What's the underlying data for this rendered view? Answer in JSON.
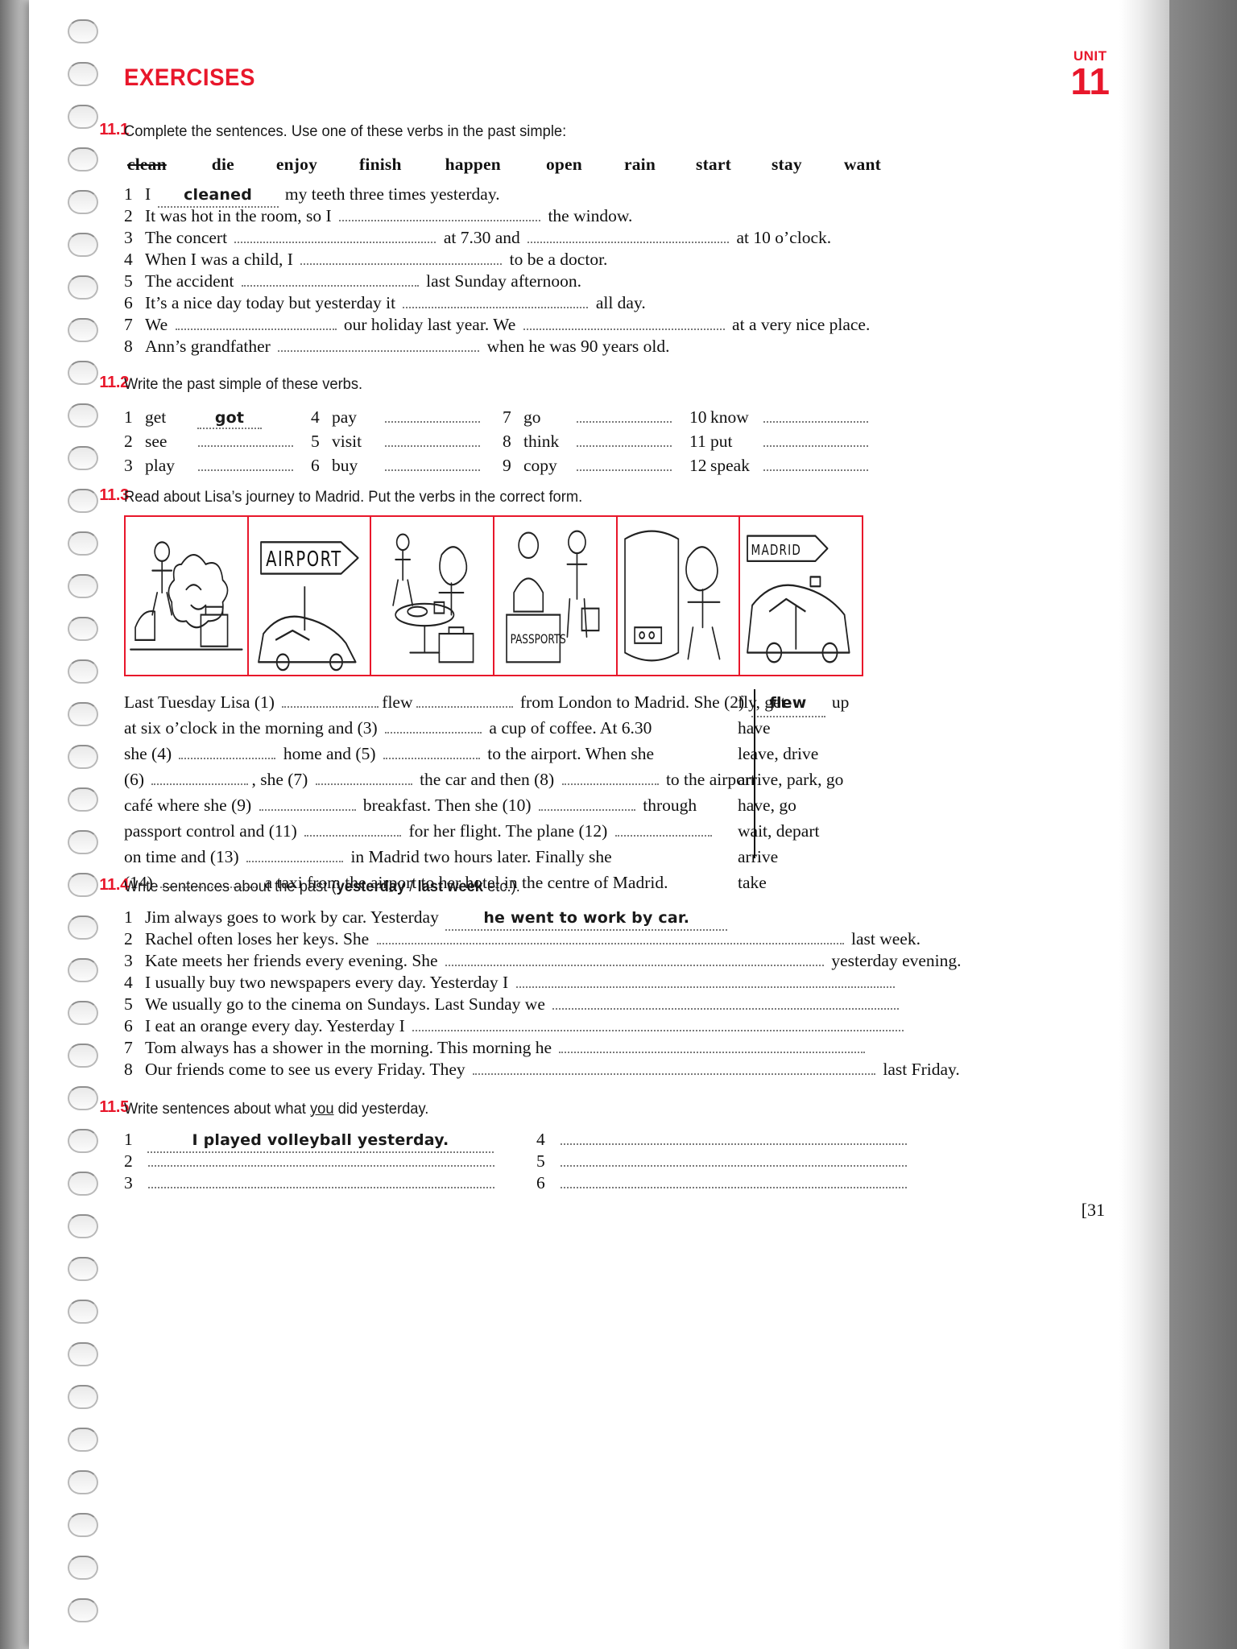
{
  "unit": {
    "label": "UNIT",
    "number": "11"
  },
  "header": {
    "title": "EXERCISES"
  },
  "page_number": "[31",
  "colors": {
    "accent_red": "#e8172b",
    "text": "#111111",
    "dots": "#7a7a7a"
  },
  "exercises": [
    {
      "number": "11.1",
      "instruction": "Complete the sentences. Use one of these verbs in the past simple:",
      "word_bank": [
        {
          "word": "clean",
          "struck": true
        },
        {
          "word": "die",
          "struck": false
        },
        {
          "word": "enjoy",
          "struck": false
        },
        {
          "word": "finish",
          "struck": false
        },
        {
          "word": "happen",
          "struck": false
        },
        {
          "word": "open",
          "struck": false
        },
        {
          "word": "rain",
          "struck": false
        },
        {
          "word": "start",
          "struck": false
        },
        {
          "word": "stay",
          "struck": false
        },
        {
          "word": "want",
          "struck": false
        }
      ],
      "items": [
        {
          "n": "1",
          "pre": "I",
          "answer": "cleaned",
          "post": "my teeth three times yesterday."
        },
        {
          "n": "2",
          "pre": "It was hot in the room, so I",
          "answer": "",
          "post": "the window."
        },
        {
          "n": "3",
          "pre": "The concert",
          "answer": "",
          "mid": "at 7.30 and",
          "post": "at 10 o’clock."
        },
        {
          "n": "4",
          "pre": "When I was a child, I",
          "answer": "",
          "post": "to be a doctor."
        },
        {
          "n": "5",
          "pre": "The accident",
          "answer": "",
          "post": "last Sunday afternoon."
        },
        {
          "n": "6",
          "pre": "It’s a nice day today but yesterday it",
          "answer": "",
          "post": "all day."
        },
        {
          "n": "7",
          "pre": "We",
          "answer": "",
          "mid": "our holiday last year. We",
          "post": "at a very nice place."
        },
        {
          "n": "8",
          "pre": "Ann’s grandfather",
          "answer": "",
          "post": "when he was 90 years old."
        }
      ]
    },
    {
      "number": "11.2",
      "instruction": "Write the past simple of these verbs.",
      "verbs": [
        {
          "n": "1",
          "verb": "get",
          "answer": "got"
        },
        {
          "n": "2",
          "verb": "see",
          "answer": ""
        },
        {
          "n": "3",
          "verb": "play",
          "answer": ""
        },
        {
          "n": "4",
          "verb": "pay",
          "answer": ""
        },
        {
          "n": "5",
          "verb": "visit",
          "answer": ""
        },
        {
          "n": "6",
          "verb": "buy",
          "answer": ""
        },
        {
          "n": "7",
          "verb": "go",
          "answer": ""
        },
        {
          "n": "8",
          "verb": "think",
          "answer": ""
        },
        {
          "n": "9",
          "verb": "copy",
          "answer": ""
        },
        {
          "n": "10",
          "verb": "know",
          "answer": ""
        },
        {
          "n": "11",
          "verb": "put",
          "answer": ""
        },
        {
          "n": "12",
          "verb": "speak",
          "answer": ""
        }
      ]
    },
    {
      "number": "11.3",
      "instruction": "Read about Lisa’s journey to Madrid. Put the verbs in the correct form.",
      "comic_panels": [
        {
          "caption": "",
          "scene": "lisa-in-bed-alarm"
        },
        {
          "caption": "AIRPORT",
          "scene": "airport-sign-car"
        },
        {
          "caption": "",
          "scene": "cafe-coffee-suitcase"
        },
        {
          "caption": "PASSPORTS",
          "scene": "passport-control"
        },
        {
          "caption": "",
          "scene": "plane-window-seat"
        },
        {
          "caption": "MADRID",
          "scene": "taxi-madrid"
        }
      ],
      "passage_lines": [
        "Last Tuesday Lisa (1) ____flew____ from London to Madrid. She (2) ________ up",
        "at six o’clock in the morning and (3) ________ a cup of coffee. At 6.30",
        "she (4) ________ home and (5) ________ to the airport. When she",
        "(6) ________, she (7) ________ the car and then (8) ________ to the airport",
        "café where she (9) ________ breakfast. Then she (10) ________ through",
        "passport control and (11) ________ for her flight. The plane (12) ________",
        "on time and (13) ________ in Madrid two hours later. Finally she",
        "(14) ________ a taxi from the airport to her hotel in the centre of Madrid."
      ],
      "filled_answer": "flew",
      "hints": [
        "fly, get",
        "have",
        "leave, drive",
        "arrive, park, go",
        "have, go",
        "wait, depart",
        "arrive",
        "take"
      ]
    },
    {
      "number": "11.4",
      "instruction_parts": [
        {
          "text": "Write sentences about the past (",
          "bold": false
        },
        {
          "text": "yesterday",
          "bold": true
        },
        {
          "text": " / ",
          "bold": false
        },
        {
          "text": "last week",
          "bold": true
        },
        {
          "text": " etc.).",
          "bold": false
        }
      ],
      "items": [
        {
          "n": "1",
          "pre": "Jim always goes to work by car.  Yesterday",
          "answer": "he went to work by car.",
          "post": ""
        },
        {
          "n": "2",
          "pre": "Rachel often loses her keys.  She",
          "answer": "",
          "post": "last week."
        },
        {
          "n": "3",
          "pre": "Kate meets her friends every evening.  She",
          "answer": "",
          "post": "yesterday evening."
        },
        {
          "n": "4",
          "pre": "I usually buy two newspapers every day.  Yesterday I",
          "answer": "",
          "post": ""
        },
        {
          "n": "5",
          "pre": "We usually go to the cinema on Sundays.  Last Sunday we",
          "answer": "",
          "post": ""
        },
        {
          "n": "6",
          "pre": "I eat an orange every day.  Yesterday I",
          "answer": "",
          "post": ""
        },
        {
          "n": "7",
          "pre": "Tom always has a shower in the morning.  This morning he",
          "answer": "",
          "post": ""
        },
        {
          "n": "8",
          "pre": "Our friends come to see us every Friday.  They",
          "answer": "",
          "post": "last Friday."
        }
      ]
    },
    {
      "number": "11.5",
      "instruction_parts": [
        {
          "text": "Write sentences about what ",
          "bold": false,
          "underline": false
        },
        {
          "text": "you",
          "bold": false,
          "underline": true
        },
        {
          "text": " did yesterday.",
          "bold": false,
          "underline": false
        }
      ],
      "items_left": [
        {
          "n": "1",
          "answer": "I played volleyball yesterday."
        },
        {
          "n": "2",
          "answer": ""
        },
        {
          "n": "3",
          "answer": ""
        }
      ],
      "items_right": [
        {
          "n": "4",
          "answer": ""
        },
        {
          "n": "5",
          "answer": ""
        },
        {
          "n": "6",
          "answer": ""
        }
      ]
    }
  ]
}
